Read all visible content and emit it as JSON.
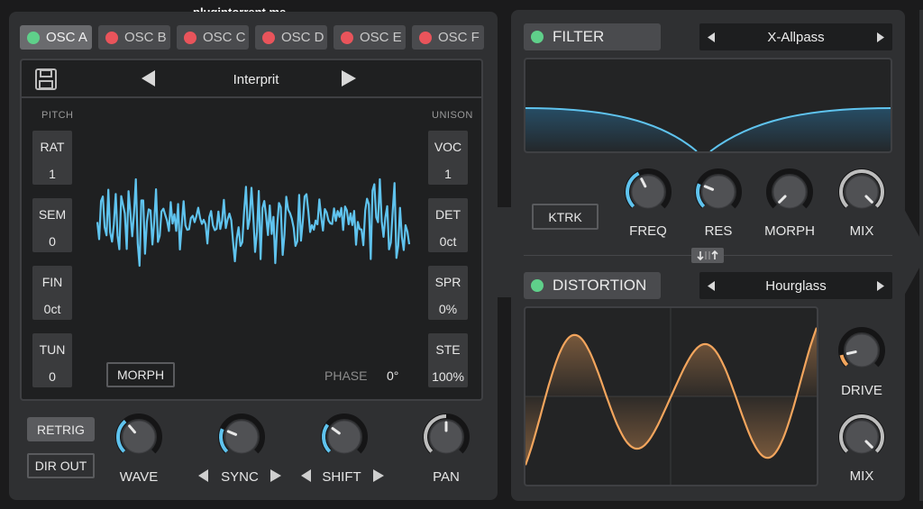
{
  "watermark": "plugintorrent.me",
  "osc_tabs": [
    {
      "label": "OSC A",
      "status": "on"
    },
    {
      "label": "OSC B",
      "status": "off"
    },
    {
      "label": "OSC C",
      "status": "off"
    },
    {
      "label": "OSC D",
      "status": "off"
    },
    {
      "label": "OSC E",
      "status": "off"
    },
    {
      "label": "OSC F",
      "status": "off"
    }
  ],
  "osc": {
    "preset_name": "Interprit",
    "pitch_header": "PITCH",
    "unison_header": "UNISON",
    "pitch_params": [
      {
        "name": "RAT",
        "value": "1"
      },
      {
        "name": "SEM",
        "value": "0"
      },
      {
        "name": "FIN",
        "value": "0ct"
      },
      {
        "name": "TUN",
        "value": "0"
      }
    ],
    "unison_params": [
      {
        "name": "VOC",
        "value": "1"
      },
      {
        "name": "DET",
        "value": "0ct"
      },
      {
        "name": "SPR",
        "value": "0%"
      },
      {
        "name": "STE",
        "value": "100%"
      }
    ],
    "morph_label": "MORPH",
    "phase_label": "PHASE",
    "phase_value": "0°",
    "retrig_label": "RETRIG",
    "dirout_label": "DIR OUT",
    "knobs": {
      "wave": "WAVE",
      "sync": "SYNC",
      "shift": "SHIFT",
      "pan": "PAN"
    }
  },
  "filter": {
    "title": "FILTER",
    "type": "X-Allpass",
    "ktrk_label": "KTRK",
    "knobs": {
      "freq": "FREQ",
      "res": "RES",
      "morph": "MORPH",
      "mix": "MIX"
    }
  },
  "distortion": {
    "title": "DISTORTION",
    "type": "Hourglass",
    "knobs": {
      "drive": "DRIVE",
      "mix": "MIX"
    }
  },
  "colors": {
    "accent_blue": "#5fc3ee",
    "accent_orange": "#f3a55d",
    "on_green": "#5fd08a",
    "off_red": "#e9545b"
  },
  "icons": {
    "save": "floppy-disk-icon",
    "prev": "triangle-left-icon",
    "next": "triangle-right-icon",
    "swap": "swap-arrows-icon"
  }
}
